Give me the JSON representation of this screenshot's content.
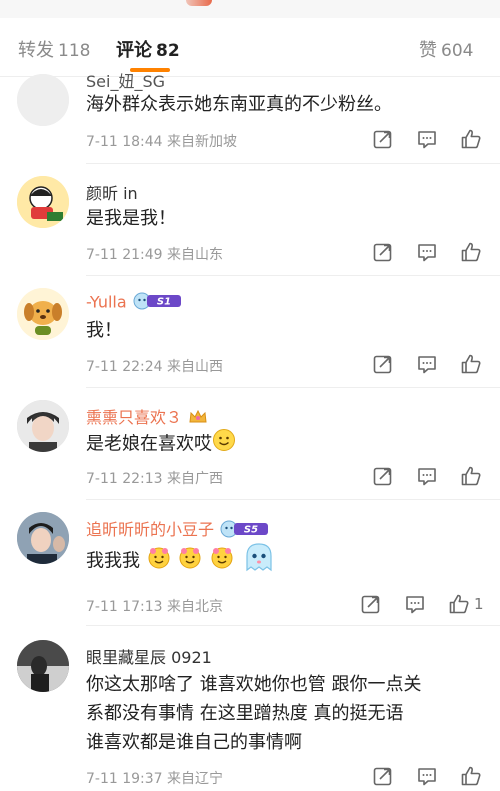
{
  "tabs": {
    "repost": {
      "label": "转发",
      "count": "118"
    },
    "comment": {
      "label": "评论",
      "count": "82"
    },
    "like": {
      "label": "赞",
      "count": "604"
    }
  },
  "colors": {
    "accent": "#ff8200",
    "vip_name": "#eb7350"
  },
  "comments": [
    {
      "name": "Sei_妞_SG",
      "text": "海外群众表示她东南亚真的不少粉丝。",
      "time": "7-11 18:44",
      "location": "来自新加坡"
    },
    {
      "name": "颜昕 in",
      "text": "是我是我！",
      "time": "7-11 21:49",
      "location": "来自山东"
    },
    {
      "name": "-Yulla",
      "badge": "S1",
      "text": "我！",
      "time": "7-11 22:24",
      "location": "来自山西"
    },
    {
      "name": "熏熏只喜欢３",
      "text": "是老娘在喜欢哎",
      "time": "7-11 22:13",
      "location": "来自广西"
    },
    {
      "name": "追昕昕昕的小豆子",
      "badge": "S5",
      "text": "我我我",
      "time": "7-11 17:13",
      "location": "来自北京",
      "likes": "1"
    },
    {
      "name": "眼里藏星辰 0921",
      "text_lines": [
        "你这太那啥了  谁喜欢她你也管  跟你一点关",
        "系都没有事情  在这里蹭热度  真的挺无语",
        "谁喜欢都是谁自己的事情啊"
      ],
      "time": "7-11 19:37",
      "location": "来自辽宁"
    }
  ]
}
